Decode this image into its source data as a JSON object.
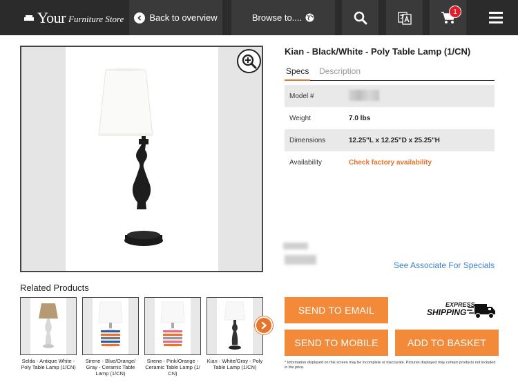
{
  "header": {
    "brand_main": "Your",
    "brand_sub": "Furniture Store",
    "back_label": "Back to overview",
    "browse_label": "Browse to....",
    "cart_count": "1"
  },
  "product": {
    "title": "Kian - Black/White - Poly Table Lamp (1/CN)",
    "tabs": [
      "Specs",
      "Description"
    ],
    "specs": [
      {
        "key": "Model #",
        "value": ""
      },
      {
        "key": "Weight",
        "value": "7.0 lbs"
      },
      {
        "key": "Dimensions",
        "value": "12.25\"L x 12.25\"D x 25.25\"H"
      },
      {
        "key": "Availability",
        "value": "Check factory availability"
      }
    ],
    "associate_link": "See Associate For Specials"
  },
  "related": {
    "title": "Related Products",
    "items": [
      {
        "caption": "Selda - Antique White - Poly Table Lamp (1/CN)"
      },
      {
        "caption": "Sirene - Blue/Orange/ Gray - Ceramic Table Lamp (1/CN)"
      },
      {
        "caption": "Sirene - Pink/Orange - Ceramic Table Lamp (1/ CN)"
      },
      {
        "caption": "Kian - White/Gray - Poly Table Lamp (1/CN)"
      }
    ]
  },
  "actions": {
    "send_email": "SEND TO EMAIL",
    "send_mobile": "SEND TO MOBILE",
    "add_basket": "ADD TO BASKET",
    "shipping_line1": "EXPRESS",
    "shipping_line2": "SHIPPING"
  },
  "disclaimer": "* Information displayed on this screen may be incomplete or inaccurate. Pictures displayed may contain products not included in the price.",
  "colors": {
    "accent": "#f28a3a",
    "header": "#2b2b2b",
    "link": "#3b80d0",
    "badge": "#e21d2a"
  }
}
